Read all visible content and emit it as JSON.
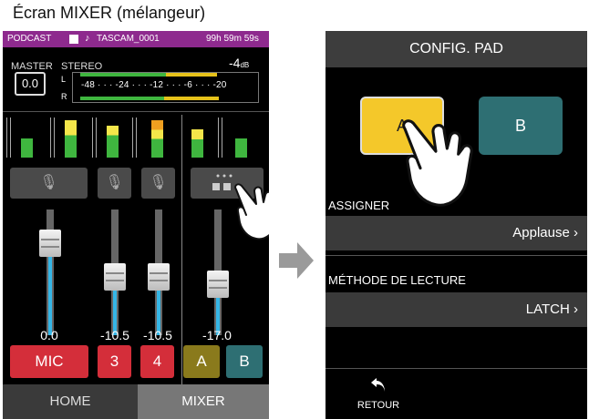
{
  "caption": "Écran MIXER (mélangeur)",
  "status_bar": {
    "mode": "PODCAST",
    "file": "TASCAM_0001",
    "remaining": "99h 59m 59s",
    "color": "#8e2a8e"
  },
  "master": {
    "label": "MASTER",
    "value": "0.0",
    "stereo_label": "STEREO",
    "peak": "-4",
    "peak_unit": "dB",
    "ch_left": "L",
    "ch_right": "R",
    "scale": "-48 · · · -24 · · · -12 · · · -6 · · · -20"
  },
  "channels": [
    {
      "label": "MIC",
      "level": "0.0",
      "color": "#d42e3a",
      "fader_pct": 0.8
    },
    {
      "label": "3",
      "level": "-10.5",
      "color": "#d42e3a",
      "fader_pct": 0.45
    },
    {
      "label": "4",
      "level": "-10.5",
      "color": "#d42e3a",
      "fader_pct": 0.45
    },
    {
      "label": "A",
      "level": "",
      "color": "#8a7a1c"
    },
    {
      "label": "B",
      "level": "-17.0",
      "color": "#2e6f73",
      "fader_pct": 0.38
    }
  ],
  "tabs": {
    "home": "HOME",
    "mixer": "MIXER"
  },
  "config": {
    "title": "CONFIG. PAD",
    "pad_a": "A",
    "pad_b": "B",
    "assign_label": "ASSIGNER",
    "assign_value": "Applause",
    "method_label": "MÉTHODE DE LECTURE",
    "method_value": "LATCH",
    "back_label": "RETOUR"
  },
  "icons": {
    "mic": "microphone-icon",
    "pad": "pad-grid-icon",
    "hand": "pointing-hand-icon",
    "arrow": "right-arrow-icon",
    "back": "back-arrow-icon",
    "chevron": "chevron-right-icon"
  }
}
